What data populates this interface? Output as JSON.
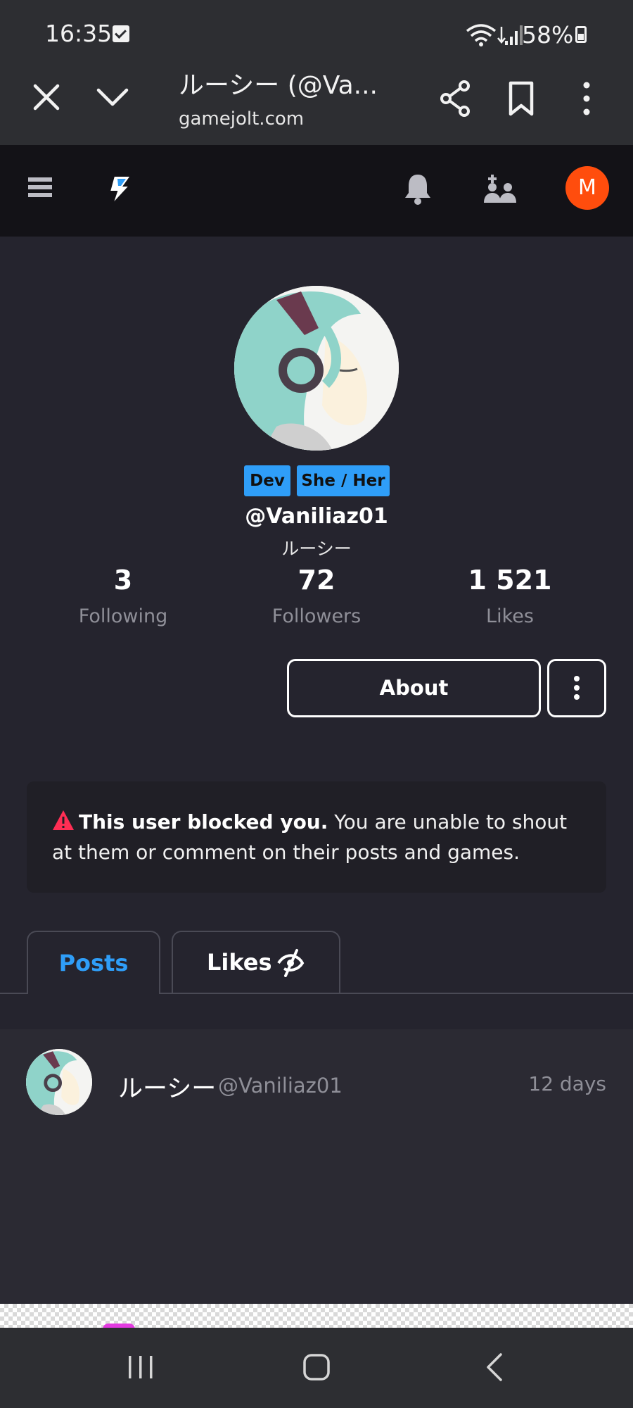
{
  "status_bar": {
    "time": "16:35",
    "battery": "58%"
  },
  "browser": {
    "tab_title": "ルーシー (@Va...",
    "domain": "gamejolt.com"
  },
  "site_nav": {
    "user_initial": "M",
    "avatar_color": "#ff4d0d"
  },
  "profile": {
    "tags": [
      "Dev",
      "She / Her"
    ],
    "username": "@Vaniliaz01",
    "display_name": "ルーシー",
    "stats": {
      "following": {
        "value": "3",
        "label": "Following"
      },
      "followers": {
        "value": "72",
        "label": "Followers"
      },
      "likes": {
        "value": "1 521",
        "label": "Likes"
      }
    },
    "about_label": "About"
  },
  "blocked_notice": {
    "bold": "This user blocked you.",
    "text": " You are unable to shout at them or comment on their posts and games."
  },
  "tabs": {
    "posts": "Posts",
    "likes": "Likes"
  },
  "post": {
    "display_name": "ルーシー",
    "handle": "@Vaniliaz01",
    "time": "12 days"
  },
  "colors": {
    "accent": "#2f9ef8",
    "background": "#25242e",
    "warning": "#ff2e54"
  },
  "icons": [
    "close-icon",
    "chevron-down-icon",
    "share-icon",
    "bookmark-icon",
    "more-vertical-icon",
    "hamburger-icon",
    "gamejolt-logo-icon",
    "bell-icon",
    "friend-requests-icon",
    "warning-icon",
    "eye-off-icon",
    "recent-apps-icon",
    "home-icon",
    "back-icon"
  ]
}
